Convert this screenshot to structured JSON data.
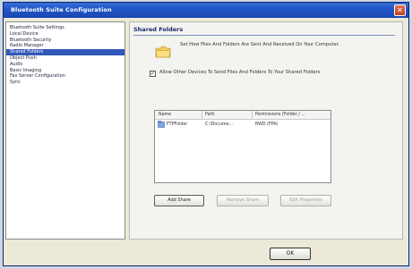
{
  "window": {
    "title": "Bluetooth Suite Configuration",
    "close_glyph": "✕"
  },
  "sidebar": {
    "items": [
      {
        "label": "Bluetooth Suite Settings"
      },
      {
        "label": "Local Device"
      },
      {
        "label": "Bluetooth Security"
      },
      {
        "label": "Radio Manager"
      },
      {
        "label": "Shared Folders",
        "selected": true
      },
      {
        "label": "Object Push"
      },
      {
        "label": "Audio"
      },
      {
        "label": "Basic Imaging"
      },
      {
        "label": "Fax Server Configuration"
      },
      {
        "label": "Sync"
      }
    ]
  },
  "main": {
    "section_title": "Shared Folders",
    "description": "Set How Files And Folders Are Sent And Received On Your Computer.",
    "allow_checkbox": {
      "checked": true,
      "check_glyph": "✓",
      "label": "Allow Other Devices To Send Files And Folders To Your Shared Folders"
    },
    "table": {
      "columns": [
        "Name",
        "Path",
        "Permissions (Folder / ..."
      ],
      "rows": [
        {
          "name": "FTPFolder",
          "path": "C:\\Docume...",
          "permissions": "RWD (FPA)"
        }
      ]
    },
    "buttons": {
      "add_share": "Add Share",
      "remove_share": "Remove Share",
      "edit_properties": "Edit Properties"
    }
  },
  "footer": {
    "ok_label": "OK"
  },
  "colors": {
    "title_bar": "#2156c8",
    "selection": "#3158b8",
    "accent_text": "#1b2a6b"
  },
  "icons": {
    "folder": "folder-icon",
    "share_row": "shared-folder-icon"
  }
}
